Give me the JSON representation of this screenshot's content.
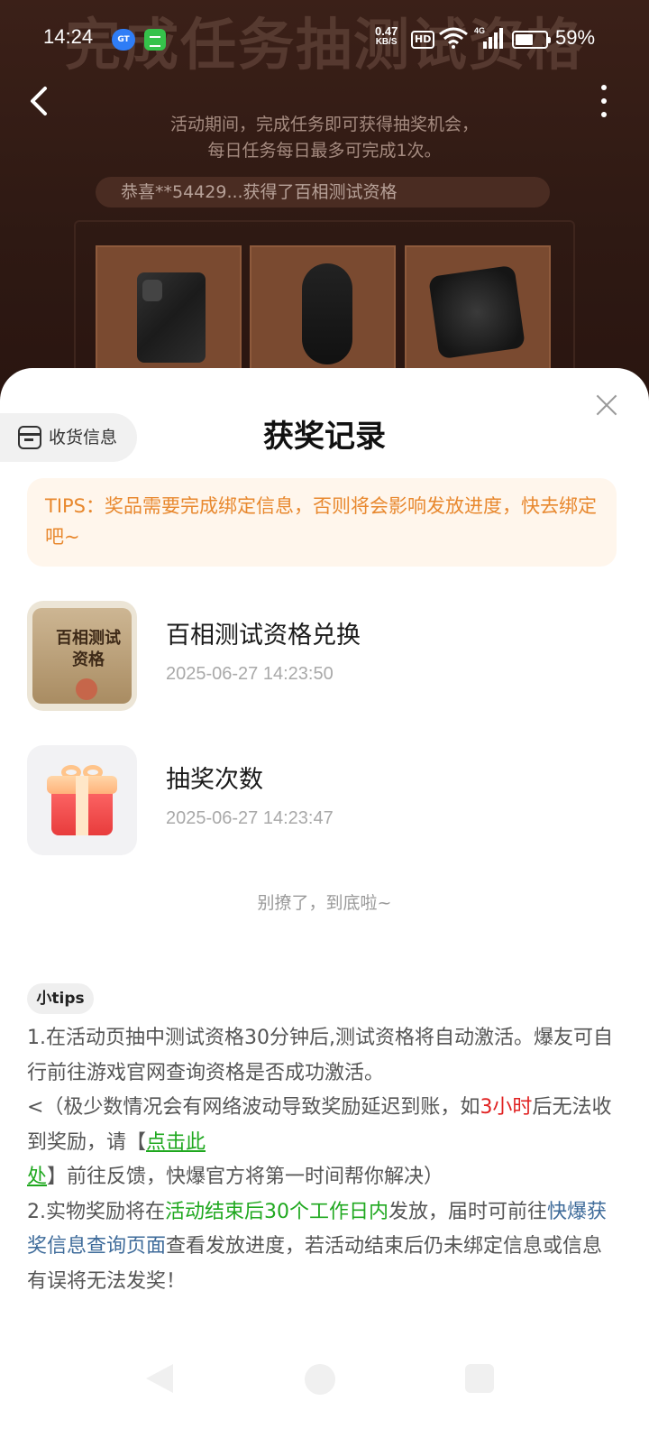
{
  "status_bar": {
    "time": "14:24",
    "app1_label": "GT",
    "speed_value": "0.47",
    "speed_unit": "KB/S",
    "hd_label": "HD",
    "network_label": "4G",
    "battery_level": 0.59,
    "battery_text": "59%"
  },
  "background": {
    "title": "完成任务抽测试资格",
    "desc_line1": "活动期间，完成任务即可获得抽奖机会，",
    "desc_line2": "每日任务每日最多可完成1次。",
    "ticker": "恭喜**54429...获得了百相测试资格",
    "prizes": [
      "phone-image",
      "gaming-mouse-image",
      "keycap-image"
    ]
  },
  "sheet": {
    "title": "获奖记录",
    "shipping_label": "收货信息",
    "tips": "TIPS：奖品需要完成绑定信息，否则将会影响发放进度，快去绑定吧~",
    "records": [
      {
        "title": "百相测试资格兑换",
        "time": "2025-06-27 14:23:50",
        "thumb_text_1": "百相测试",
        "thumb_text_2": "资格"
      },
      {
        "title": "抽奖次数",
        "time": "2025-06-27 14:23:47"
      }
    ],
    "end_text": "别撩了，到底啦~",
    "small_tips_label": "小tips",
    "notes": {
      "p1": "1.在活动页抽中测试资格30分钟后,测试资格将自动激活。爆友可自行前往游戏官网查询资格是否成功激活。",
      "p2_a": "<（极少数情况会有网络波动导致奖励延迟到账，如",
      "p2_red": "3小时",
      "p2_b": "后无法收到奖励，请【",
      "p2_link": "点击此处",
      "p2_c": "】前往反馈，快爆官方将第一时间帮你解决）",
      "p3_a": "2.实物奖励将在",
      "p3_green": "活动结束后30个工作日内",
      "p3_b": "发放，届时可前往",
      "p3_navy": "快爆获奖信息查询页面",
      "p3_c": "查看发放进度，若活动结束后仍未绑定信息或信息有误将无法发奖！"
    }
  },
  "colors": {
    "tips_text": "#e8882e",
    "tips_bg": "#fff6ec",
    "highlight_red": "#e02020",
    "highlight_green": "#1fa81f",
    "highlight_navy": "#3e6b9a"
  }
}
